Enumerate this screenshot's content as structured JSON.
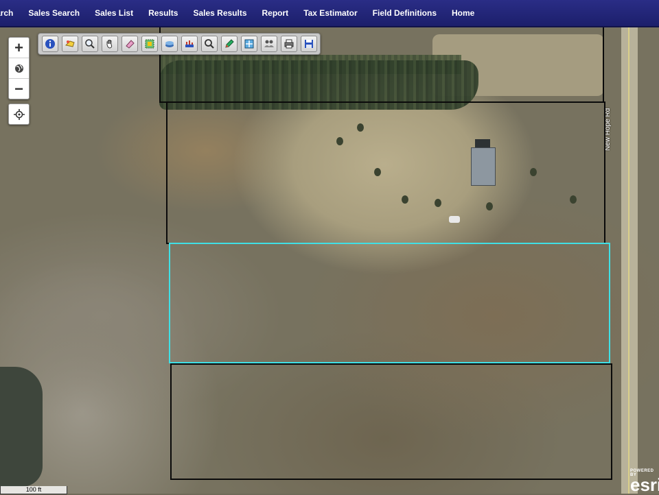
{
  "nav": {
    "items": [
      "arch",
      "Sales Search",
      "Sales List",
      "Results",
      "Sales Results",
      "Report",
      "Tax Estimator",
      "Field Definitions",
      "Home"
    ]
  },
  "map": {
    "road_label": "New Hope Rd",
    "scale_label": "100 ft",
    "attribution_powered": "POWERED BY",
    "attribution_word": "esri"
  },
  "zoom": {
    "in_label": "+",
    "out_label": "−"
  },
  "toolbar": {
    "tools": [
      "info-icon",
      "identify-icon",
      "zoom-select-icon",
      "pan-hand-icon",
      "eraser-icon",
      "select-area-icon",
      "layers-icon",
      "buffer-icon",
      "search-icon",
      "draw-pencil-icon",
      "full-extent-icon",
      "users-icon",
      "print-icon",
      "save-icon"
    ]
  },
  "colors": {
    "nav_bg": "#22267a",
    "selected_parcel": "#3fe0e6",
    "parcel_line": "#0a0a0a"
  }
}
